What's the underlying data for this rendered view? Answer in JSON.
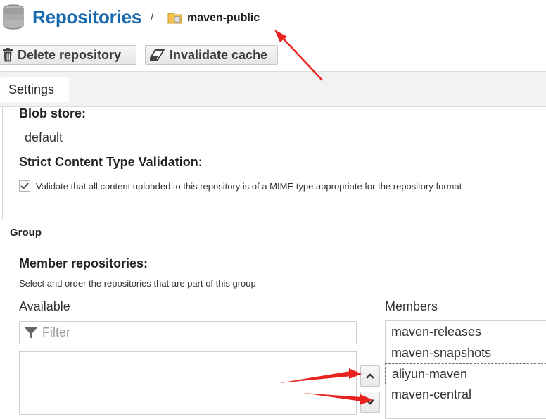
{
  "header": {
    "title": "Repositories",
    "separator": "/",
    "repository_name": "maven-public",
    "title_icon": "database-icon",
    "repository_icon": "repository-group-icon"
  },
  "toolbar": {
    "delete_label": "Delete repository",
    "delete_icon": "trash-icon",
    "invalidate_label": "Invalidate cache",
    "invalidate_icon": "eraser-icon"
  },
  "tabs": [
    {
      "label": "Settings",
      "active": true
    }
  ],
  "settings": {
    "blob_store_label": "Blob store:",
    "blob_store_value": "default",
    "strict_label": "Strict Content Type Validation:",
    "strict_checkbox_label": "Validate that all content uploaded to this repository is of a MIME type appropriate for the repository format",
    "strict_checked": true
  },
  "group": {
    "section_label": "Group",
    "member_label": "Member repositories:",
    "member_help": "Select and order the repositories that are part of this group",
    "available_label": "Available",
    "filter_placeholder": "Filter",
    "filter_icon": "filter-icon",
    "members_label": "Members",
    "members": [
      {
        "name": "maven-releases",
        "selected": false
      },
      {
        "name": "maven-snapshots",
        "selected": false
      },
      {
        "name": "aliyun-maven",
        "selected": true
      },
      {
        "name": "maven-central",
        "selected": false
      }
    ],
    "move_up_icon": "chevron-up-icon",
    "move_down_icon": "chevron-down-icon"
  },
  "colors": {
    "title": "#1569b0",
    "annotation": "#e8231f",
    "tabbar": "#f2f2f2"
  }
}
